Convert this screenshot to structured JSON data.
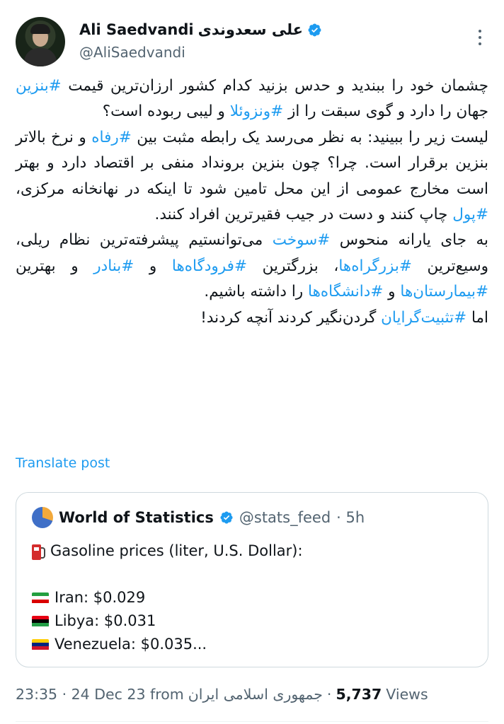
{
  "author": {
    "name_en": "Ali Saedvandi",
    "name_fa": "علی سعدوندی",
    "handle": "@AliSaedvandi"
  },
  "tweet": {
    "paragraphs": [
      [
        {
          "t": "چشمان خود را ببندید و حدس بزنید کدام کشور ارزان‌ترین قیمت "
        },
        {
          "t": "#بنزین",
          "tag": true
        },
        {
          "t": " جهان را دارد و گوی سبقت را از "
        },
        {
          "t": "#ونزوئلا",
          "tag": true
        },
        {
          "t": " و لیبی ربوده است؟"
        }
      ],
      [
        {
          "t": "لیست زیر را ببینید: به نظر می‌رسد یک رابطه مثبت بین "
        },
        {
          "t": "#رفاه",
          "tag": true
        },
        {
          "t": " و نرخ بالاتر بنزین برقرار است. چرا؟ چون بنزین برونداد منفی بر اقتصاد دارد و بهتر است مخارج عمومی از این محل تامین شود تا اینکه در نهانخانه مرکزی، "
        },
        {
          "t": "#پول",
          "tag": true
        },
        {
          "t": " چاپ کنند و دست در جیب فقیرترین افراد کنند."
        }
      ],
      [
        {
          "t": "به جای یارانه منحوس "
        },
        {
          "t": "#سوخت",
          "tag": true
        },
        {
          "t": " می‌توانستیم پیشرفته‌ترین نظام ریلی، وسیع‌ترین "
        },
        {
          "t": "#بزرگراه‌ها",
          "tag": true
        },
        {
          "t": "، بزرگترین "
        },
        {
          "t": "#فرودگاه‌ها",
          "tag": true
        },
        {
          "t": " و "
        },
        {
          "t": "#بنادر",
          "tag": true
        },
        {
          "t": " و بهترین "
        },
        {
          "t": "#بیمارستان‌ها",
          "tag": true
        },
        {
          "t": " و "
        },
        {
          "t": "#دانشگاه‌ها",
          "tag": true
        },
        {
          "t": " را داشته باشیم."
        }
      ],
      [
        {
          "t": "اما "
        },
        {
          "t": "#تثبیت‌گرایان",
          "tag": true
        },
        {
          "t": " گردن‌نگیر کردند آنچه کردند!"
        }
      ]
    ],
    "translate_label": "Translate post"
  },
  "quote": {
    "name": "World of Statistics",
    "handle": "@stats_feed",
    "time": "· 5h",
    "title": "Gasoline prices (liter, U.S. Dollar):",
    "items": [
      {
        "text": "Iran: $0.029",
        "flag": [
          "#239f40",
          "#ffffff",
          "#da0000"
        ]
      },
      {
        "text": "Libya: $0.031",
        "flag": [
          "#e70013",
          "#000000",
          "#239e46"
        ]
      },
      {
        "text": "Venezuela: $0.035...",
        "flag": [
          "#ffcc00",
          "#00247d",
          "#cf142b"
        ]
      }
    ]
  },
  "meta": {
    "time": "23:35 · 24 Dec 23 from",
    "location": "جمهوری اسلامی ایران",
    "dot": "·",
    "views_count": "5,737",
    "views_label": "Views"
  },
  "colors": {
    "link": "#1d9bf0",
    "muted": "#536471",
    "verified": "#1d9bf0"
  }
}
